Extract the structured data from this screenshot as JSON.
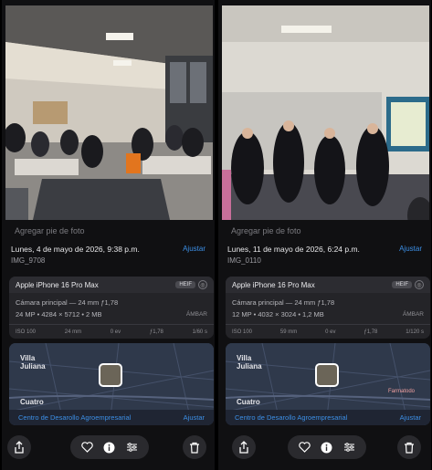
{
  "panels": [
    {
      "caption_placeholder": "Agregar pie de foto",
      "datetime": "Lunes, 4 de mayo de 2026, 9:38 p.m.",
      "adjust": "Ajustar",
      "filename": "IMG_9708",
      "device": "Apple iPhone 16 Pro Max",
      "format_badge": "HEIF",
      "camera_line": "Cámara principal — 24 mm ƒ1,78",
      "specs_line": "24 MP • 4284 × 5712 • 2 MB",
      "color_profile": "ÁMBAR",
      "exif": [
        "ISO 100",
        "24 mm",
        "0 ev",
        "ƒ1,78",
        "1/60 s"
      ],
      "map_labels": {
        "area": "Villa Juliana",
        "area_lines": [
          "Villa",
          "Juliana"
        ],
        "other": "Cuatro"
      },
      "location": "Centro de Desarollo Agroempresarial",
      "location_adjust": "Ajustar"
    },
    {
      "caption_placeholder": "Agregar pie de foto",
      "datetime": "Lunes, 11 de mayo de 2026, 6:24 p.m.",
      "adjust": "Ajustar",
      "filename": "IMG_0110",
      "device": "Apple iPhone 16 Pro Max",
      "format_badge": "HEIF",
      "camera_line": "Cámara principal — 24 mm ƒ1,78",
      "specs_line": "12 MP • 4032 × 3024 • 1,2 MB",
      "color_profile": "ÁMBAR",
      "exif": [
        "ISO 100",
        "59 mm",
        "0 ev",
        "ƒ1,78",
        "1/120 s"
      ],
      "map_labels": {
        "area": "Villa Juliana",
        "area_lines": [
          "Villa",
          "Juliana"
        ],
        "other": "Cuatro",
        "poi": "Farmatodo"
      },
      "location": "Centro de Desarollo Agroempresarial",
      "location_adjust": "Ajustar"
    }
  ],
  "icons": [
    "share-icon",
    "heart-icon",
    "info-icon",
    "adjust-icon",
    "trash-icon"
  ],
  "colors": {
    "accent": "#3c8fe6",
    "background": "#101012",
    "card": "#242428"
  }
}
